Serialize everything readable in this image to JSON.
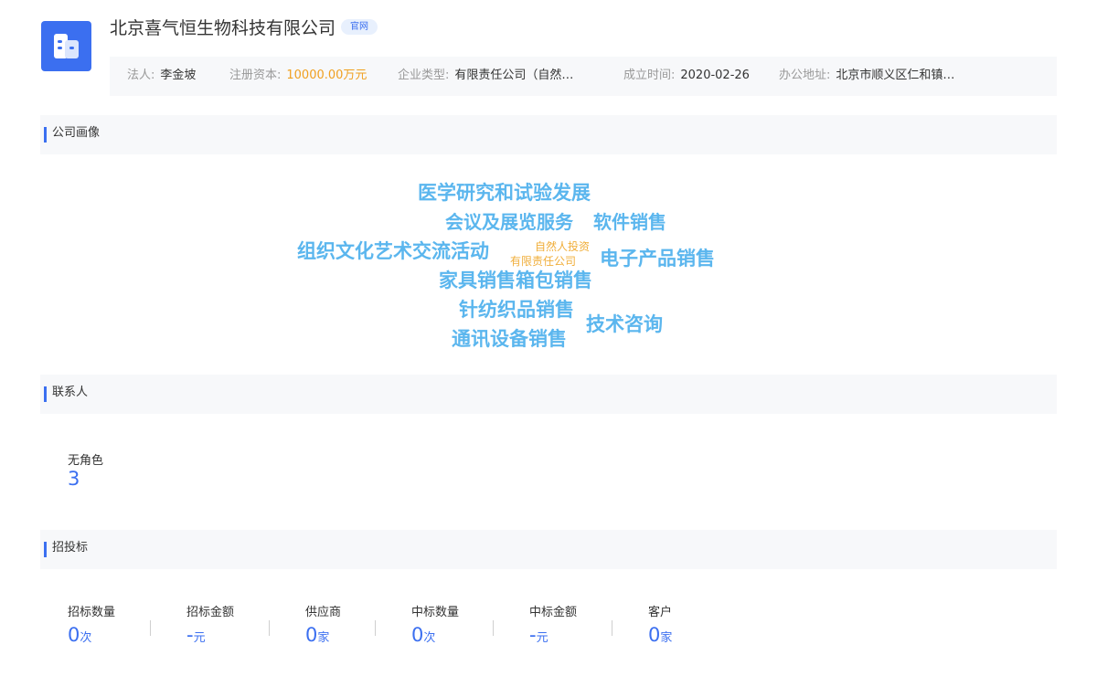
{
  "company": {
    "name": "北京喜气恒生物科技有限公司",
    "site_badge": "官网"
  },
  "info": {
    "legal_person": {
      "label": "法人:",
      "value": "李金坡"
    },
    "capital": {
      "label": "注册资本:",
      "value": "10000.00万元"
    },
    "type": {
      "label": "企业类型:",
      "value": "有限责任公司（自然…"
    },
    "founded": {
      "label": "成立时间:",
      "value": "2020-02-26"
    },
    "address": {
      "label": "办公地址:",
      "value": "北京市顺义区仁和镇…"
    }
  },
  "sections": {
    "portrait": "公司画像",
    "contacts": "联系人",
    "bidding": "招投标"
  },
  "word_cloud": [
    "医学研究和试验发展",
    "会议及展览服务",
    "软件销售",
    "组织文化艺术交流活动",
    "自然人投资",
    "有限责任公司",
    "电子产品销售",
    "家具销售箱包销售",
    "针纺织品销售",
    "技术咨询",
    "通讯设备销售"
  ],
  "contacts": {
    "label": "无角色",
    "value": "3"
  },
  "bidding_stats": [
    {
      "label": "招标数量",
      "value": "0",
      "unit": "次"
    },
    {
      "label": "招标金额",
      "value": "-",
      "unit": "元"
    },
    {
      "label": "供应商",
      "value": "0",
      "unit": "家"
    },
    {
      "label": "中标数量",
      "value": "0",
      "unit": "次"
    },
    {
      "label": "中标金额",
      "value": "-",
      "unit": "元"
    },
    {
      "label": "客户",
      "value": "0",
      "unit": "家"
    }
  ],
  "colors": {
    "accent": "#3b6ff0",
    "cloud_word": "#5bb6ee",
    "cloud_small": "#f0ae3a",
    "capital": "#f0a020"
  }
}
